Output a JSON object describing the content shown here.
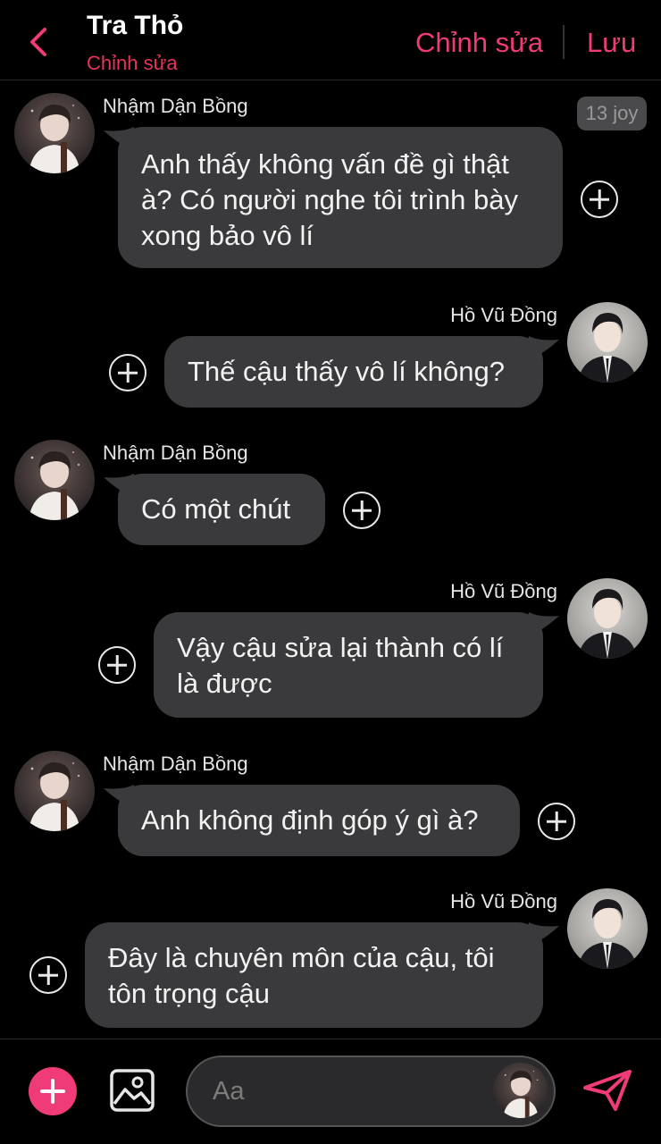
{
  "header": {
    "title": "Tra Thỏ",
    "subtitle": "Chỉnh sửa",
    "edit_label": "Chỉnh sửa",
    "save_label": "Lưu"
  },
  "timestamp": "13 joy",
  "messages": [
    {
      "sender": "Nhậm Dận Bồng",
      "side": "left",
      "text_lines": [
        "Anh thấy không vấn đề gì thật",
        "à? Có người nghe tôi trình bày",
        "xong bảo vô lí"
      ]
    },
    {
      "sender": "Hồ Vũ Đồng",
      "side": "right",
      "text_lines": [
        "Thế cậu thấy vô lí không?"
      ]
    },
    {
      "sender": "Nhậm Dận Bồng",
      "side": "left",
      "text_lines": [
        "Có một chút"
      ]
    },
    {
      "sender": "Hồ Vũ Đồng",
      "side": "right",
      "text_lines": [
        "Vậy cậu sửa lại thành có lí",
        "là được"
      ]
    },
    {
      "sender": "Nhậm Dận Bồng",
      "side": "left",
      "text_lines": [
        "Anh không định góp ý gì à?"
      ]
    },
    {
      "sender": "Hồ Vũ Đồng",
      "side": "right",
      "text_lines": [
        "Đây là chuyên môn của cậu, tôi",
        "tôn trọng cậu"
      ]
    }
  ],
  "composer": {
    "placeholder": "Aa"
  },
  "colors": {
    "accent": "#ef3b78",
    "subtitle": "#e8345a",
    "bubble": "#3a3a3c",
    "background": "#000000"
  },
  "icons": [
    "chevron-left-icon",
    "plus-circle-icon",
    "add-icon",
    "image-icon",
    "send-icon"
  ]
}
